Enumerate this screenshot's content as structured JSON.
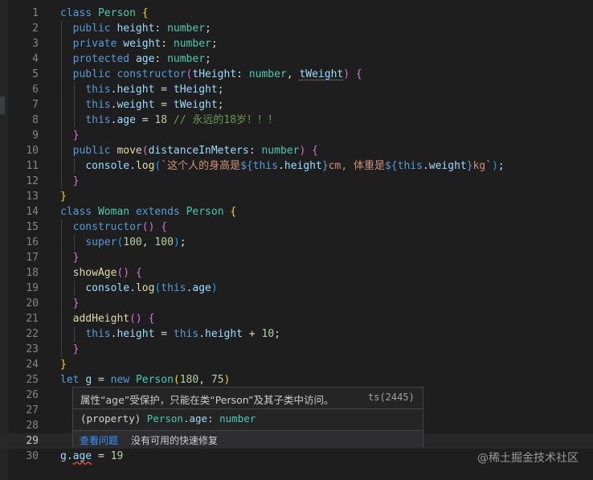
{
  "editor": {
    "line_numbers": [
      "1",
      "2",
      "3",
      "4",
      "5",
      "6",
      "7",
      "8",
      "9",
      "10",
      "11",
      "12",
      "13",
      "14",
      "15",
      "16",
      "17",
      "18",
      "19",
      "20",
      "21",
      "22",
      "23",
      "24",
      "25",
      "26",
      "27",
      "28",
      "29",
      "30"
    ],
    "current_line": 29
  },
  "hover": {
    "message": "属性“age”受保护，只能在类“Person”及其子类中访问。",
    "code": "ts(2445)",
    "signature_prefix": "(property) ",
    "signature_class": "Person",
    "signature_dot": ".",
    "signature_prop": "age",
    "signature_colon": ": ",
    "signature_type": "number",
    "view_problem": "查看问题",
    "no_fix": "没有可用的快速修复"
  },
  "watermark": "@稀土掘金技术社区",
  "colors": {
    "background": "#1e1e1e",
    "keyword": "#569cd6",
    "type": "#4ec9b0",
    "function": "#dcdcaa",
    "property": "#9cdcfe",
    "number": "#b5cea8",
    "string": "#ce9178",
    "comment": "#6a9955",
    "error": "#f14c4c",
    "link": "#3794ff"
  }
}
